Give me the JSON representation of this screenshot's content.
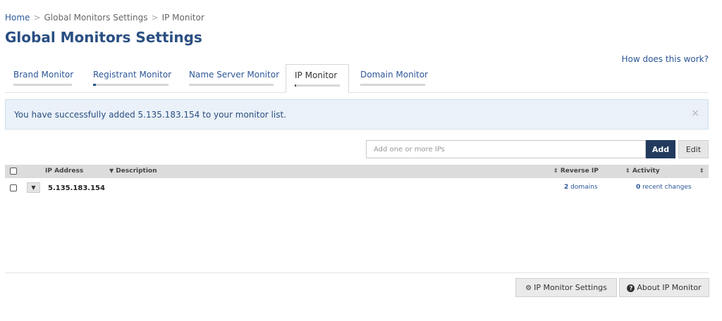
{
  "breadcrumb": {
    "home": "Home",
    "sep1": ">",
    "settings": "Global Monitors Settings",
    "sep2": ">",
    "current": "IP Monitor"
  },
  "page_title": "Global Monitors Settings",
  "help_link": "How does this work?",
  "tabs": [
    {
      "label": "Brand Monitor",
      "active": false
    },
    {
      "label": "Registrant Monitor",
      "active": false
    },
    {
      "label": "Name Server Monitor",
      "active": false
    },
    {
      "label": "IP Monitor",
      "active": true
    },
    {
      "label": "Domain Monitor",
      "active": false
    }
  ],
  "alert": {
    "message": "You have successfully added 5.135.183.154 to your monitor list.",
    "close": "×"
  },
  "add_form": {
    "placeholder": "Add one or more IPs",
    "value": "",
    "add_label": "Add",
    "edit_label": "Edit"
  },
  "table": {
    "headers": {
      "ip_address": "IP Address",
      "description": "Description",
      "reverse_ip": "Reverse IP",
      "activity": "Activity"
    },
    "rows": [
      {
        "ip": "5.135.183.154",
        "reverse_ip_count": "2",
        "reverse_ip_text": "domains",
        "activity_count": "0",
        "activity_text": "recent changes",
        "checked": false
      }
    ]
  },
  "footer": {
    "settings_label": "IP Monitor Settings",
    "about_label": "About IP Monitor"
  },
  "icons": {
    "caret_down": "▼",
    "sort": "⇕",
    "gear": "⚙",
    "question": "?"
  },
  "colors": {
    "link": "#2c5697",
    "title": "#2a4f82",
    "alert_bg": "#eaf1f8",
    "add_button": "#223a5e",
    "table_head": "#dcdcdc"
  }
}
